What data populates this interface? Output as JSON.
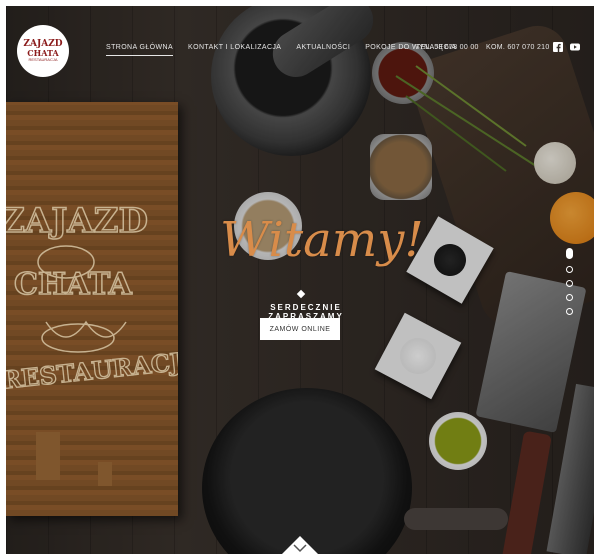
{
  "brand": {
    "line1": "ZAJAZD",
    "line2": "CHATA",
    "line3": "RESTAURACJA",
    "board_lines": [
      "ZAJAZD",
      "CHATA",
      "RESTAURACJA"
    ]
  },
  "nav": {
    "items": [
      {
        "label": "STRONA GŁÓWNA",
        "active": true
      },
      {
        "label": "KONTAKT I LOKALIZACJA",
        "active": false
      },
      {
        "label": "AKTUALNOŚCI",
        "active": false
      },
      {
        "label": "POKOJE DO WYNAJĘCIA",
        "active": false
      }
    ]
  },
  "contact": {
    "tel": "TEL. 58 678 00 00",
    "kom": "KOM. 607 070 210"
  },
  "social": {
    "facebook_icon": "facebook-icon",
    "youtube_icon": "youtube-icon"
  },
  "hero": {
    "title": "Witamy!",
    "subtitle": "SERDECZNIE ZAPRASZAMY",
    "cta": "ZAMÓW ONLINE",
    "slides": 5,
    "active_slide": 1
  },
  "colors": {
    "accent": "#d88c4a",
    "logo_red": "#8b1b1b",
    "text_light": "#e6e6e6"
  },
  "icons": {
    "scroll_down": "chevron-down-icon"
  }
}
